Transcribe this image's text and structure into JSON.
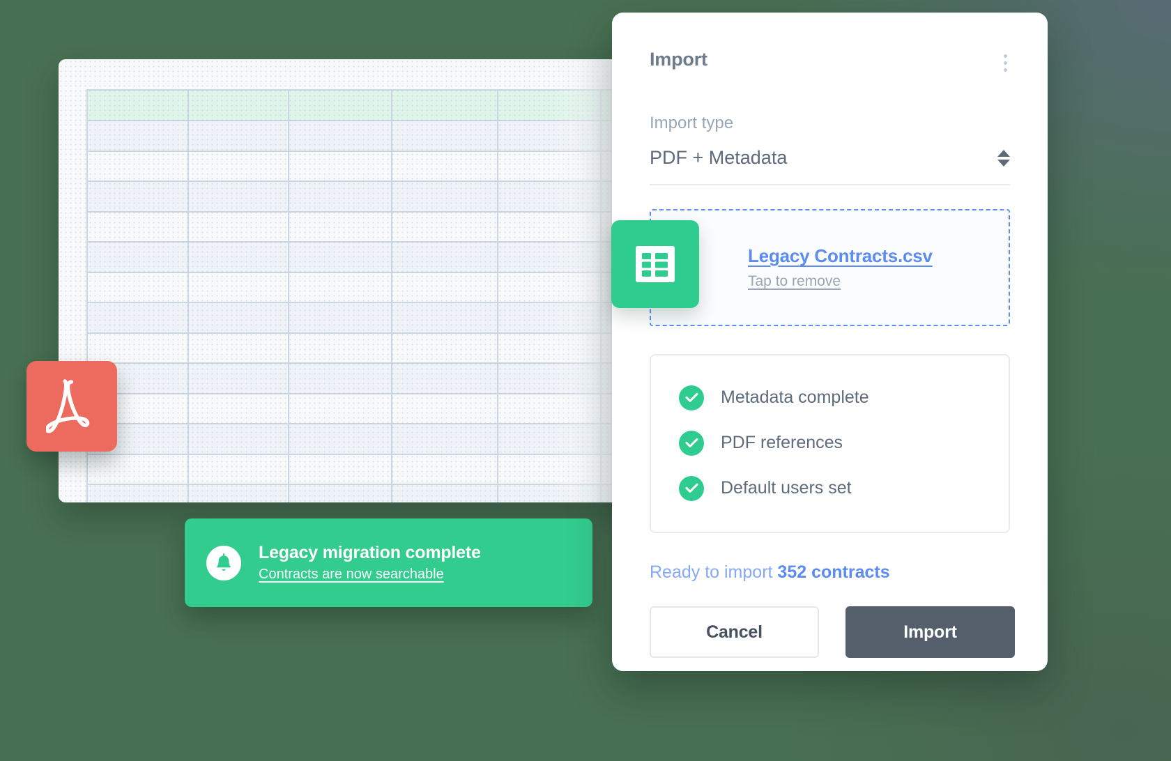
{
  "background": {
    "color": "#487052"
  },
  "spreadsheet": {
    "name": "legacy-contracts-sheet",
    "columns": 6,
    "rows": 14,
    "header_fill": "#dff5ea",
    "border_color": "#ccd6e2"
  },
  "pdf_badge": {
    "icon": "pdf-icon",
    "color": "#ed6a5e"
  },
  "toast": {
    "icon": "bell-icon",
    "title": "Legacy migration complete",
    "subtitle": "Contracts are now searchable",
    "color": "#33cc8f"
  },
  "panel": {
    "title": "Import",
    "menu_icon": "kebab-menu-icon",
    "import_type": {
      "label": "Import type",
      "value": "PDF + Metadata",
      "stepper_icons": [
        "triangle-up-icon",
        "triangle-down-icon"
      ]
    },
    "dropzone": {
      "file_icon": "csv-spreadsheet-icon",
      "file_name": "Legacy Contracts.csv",
      "remove_action": "Tap to remove",
      "border_color": "#5c8cf0"
    },
    "checklist": [
      {
        "icon": "check-circle-icon",
        "label": "Metadata complete"
      },
      {
        "icon": "check-circle-icon",
        "label": "PDF references"
      },
      {
        "icon": "check-circle-icon",
        "label": "Default users set"
      }
    ],
    "ready": {
      "prefix": "Ready to import ",
      "count_text": "352 contracts",
      "color": "#5c8cf0"
    },
    "buttons": {
      "cancel": "Cancel",
      "import": "Import"
    }
  }
}
